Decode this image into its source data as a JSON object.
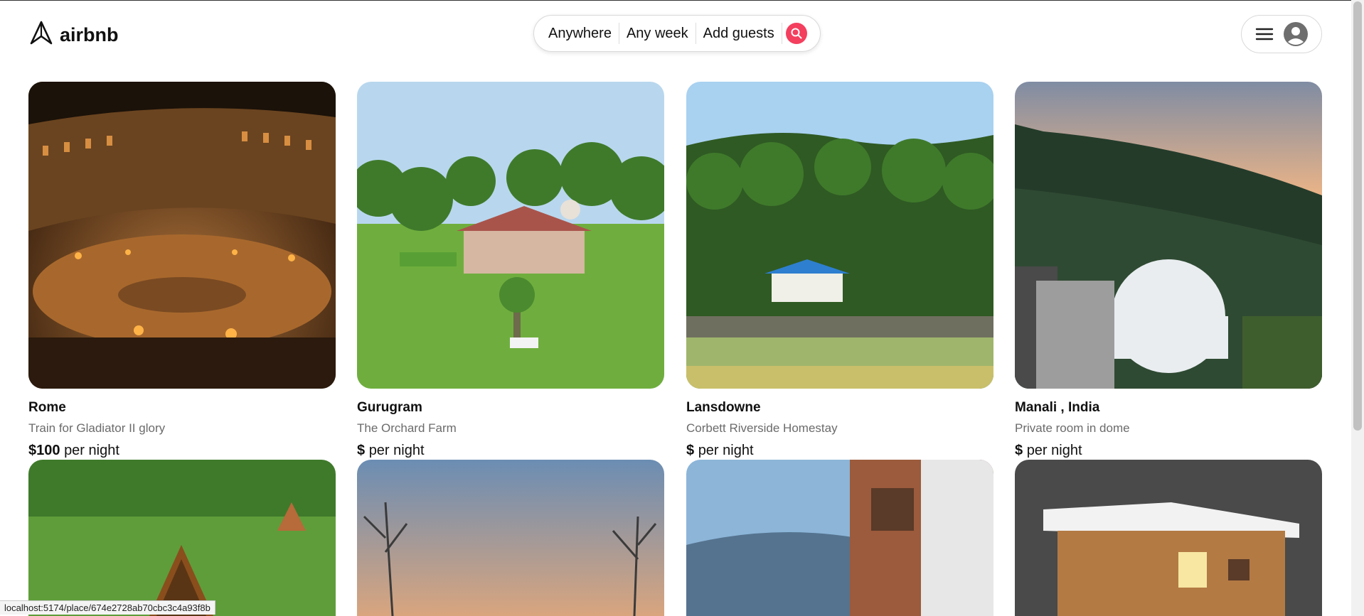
{
  "brand": {
    "name": "airbnb"
  },
  "search": {
    "where": "Anywhere",
    "when": "Any week",
    "who": "Add guests"
  },
  "listings": [
    {
      "title": "Rome",
      "subtitle": "Train for Gladiator II glory",
      "price_amount": "$100",
      "price_unit": "per night"
    },
    {
      "title": "Gurugram",
      "subtitle": "The Orchard Farm",
      "price_amount": "$",
      "price_unit": "per night"
    },
    {
      "title": "Lansdowne",
      "subtitle": "Corbett Riverside Homestay",
      "price_amount": "$",
      "price_unit": "per night"
    },
    {
      "title": "Manali , India",
      "subtitle": "Private room in dome",
      "price_amount": "$",
      "price_unit": "per night"
    }
  ],
  "status_url": "localhost:5174/place/674e2728ab70cbc3c4a93f8b",
  "colors": {
    "accent": "#f43f5e",
    "text_muted": "#6b6b6b"
  }
}
